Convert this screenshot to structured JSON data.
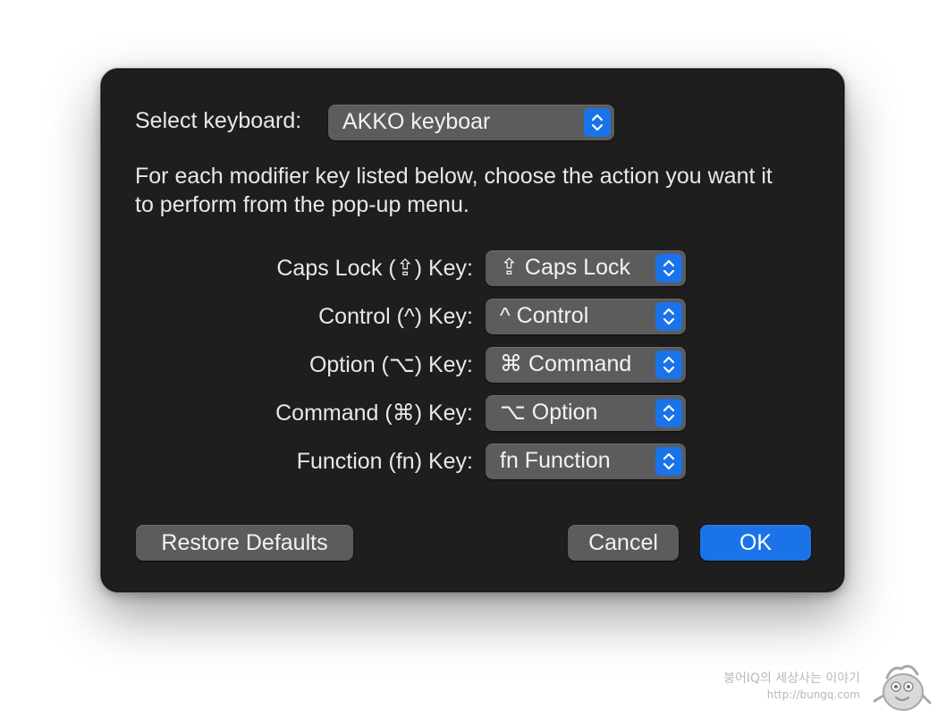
{
  "dialog": {
    "select_keyboard_label": "Select keyboard:",
    "keyboard_value": "AKKO  keyboar",
    "description": "For each modifier key listed below, choose the action you want it to perform from the pop-up menu.",
    "modifiers": [
      {
        "label": "Caps Lock (⇪) Key:",
        "value": "⇪ Caps Lock"
      },
      {
        "label": "Control (^) Key:",
        "value": "^ Control"
      },
      {
        "label": "Option (⌥) Key:",
        "value": "⌘ Command"
      },
      {
        "label": "Command (⌘) Key:",
        "value": "⌥ Option"
      },
      {
        "label": "Function (fn) Key:",
        "value": "fn Function"
      }
    ],
    "buttons": {
      "restore_defaults": "Restore Defaults",
      "cancel": "Cancel",
      "ok": "OK"
    },
    "accent_color": "#1a73e8",
    "icons": [
      "up-down-arrows-icon"
    ]
  },
  "watermark": {
    "line1": "붕어IQ의 세상사는 이야기",
    "line2": "http://bungq.com",
    "icon": "mascot-icon"
  }
}
